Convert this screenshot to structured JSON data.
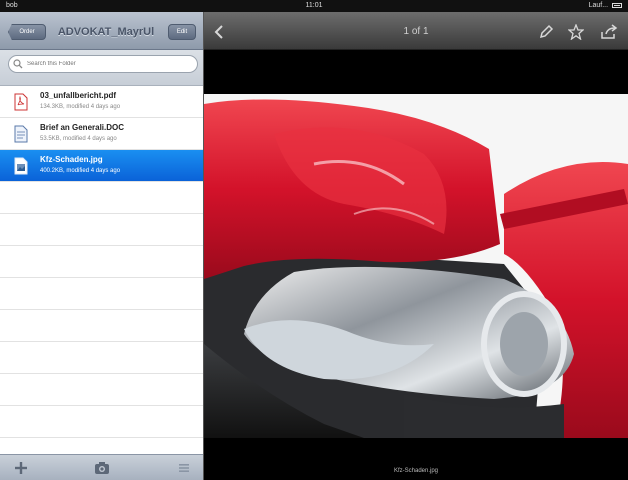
{
  "statusbar": {
    "carrier": "bob",
    "time": "11:01",
    "right_text": "Lauf..."
  },
  "sidebar": {
    "back_label": "Order",
    "title": "ADVOKAT_MayrUl",
    "edit_label": "Edit",
    "search_placeholder": "Search this Folder",
    "files": [
      {
        "name": "03_unfallbericht.pdf",
        "meta": "134.3KB, modified 4 days ago",
        "icon": "pdf-icon",
        "selected": false
      },
      {
        "name": "Brief an Generali.DOC",
        "meta": "53.5KB, modified 4 days ago",
        "icon": "doc-icon",
        "selected": false
      },
      {
        "name": "Kfz-Schaden.jpg",
        "meta": "400.2KB, modified 4 days ago",
        "icon": "image-icon",
        "selected": true
      }
    ]
  },
  "main": {
    "page_count": "1 of 1",
    "caption": "Kfz-Schaden.jpg"
  },
  "colors": {
    "selection": "#0a62d8",
    "car_red": "#d3122a"
  }
}
